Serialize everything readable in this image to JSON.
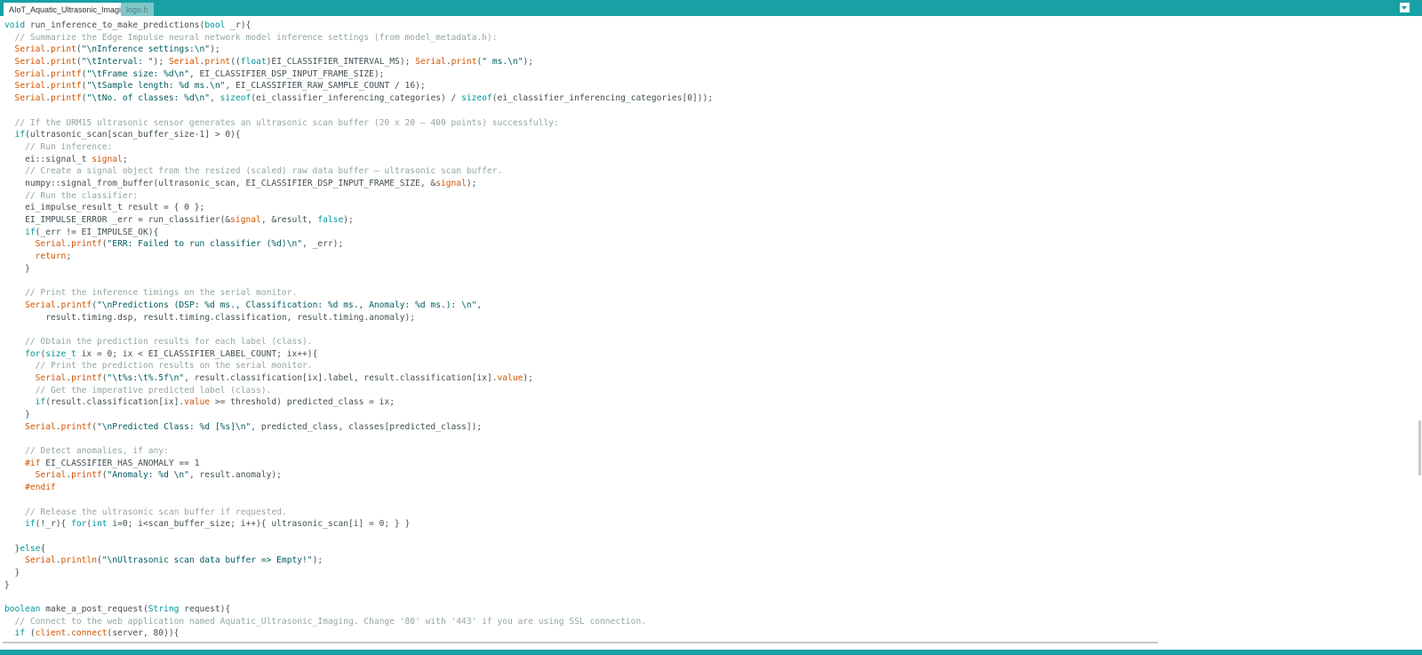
{
  "tabs": [
    {
      "label": "AIoT_Aquatic_Ultrasonic_Imaging",
      "active": true
    },
    {
      "label": "logo.h",
      "active": false
    }
  ],
  "icons": {
    "tab_menu": "chevron-down-icon"
  },
  "colors": {
    "tabbar": "#17a1a5",
    "keyword": "#00979c",
    "object": "#d35400",
    "comment": "#95a5a6",
    "string": "#005c5f",
    "text": "#434f54"
  },
  "code_lines": [
    [
      [
        "kw",
        "void"
      ],
      [
        "t",
        " run_inference_to_make_predictions("
      ],
      [
        "kw",
        "bool"
      ],
      [
        "t",
        " _r){"
      ]
    ],
    [
      [
        "cm",
        "  // Summarize the Edge Impulse neural network model inference settings (from model_metadata.h):"
      ]
    ],
    [
      [
        "obj",
        "  Serial"
      ],
      [
        "t",
        "."
      ],
      [
        "obj",
        "print"
      ],
      [
        "t",
        "("
      ],
      [
        "st",
        "\"\\nInference settings:\\n\""
      ],
      [
        "t",
        ");"
      ]
    ],
    [
      [
        "obj",
        "  Serial"
      ],
      [
        "t",
        "."
      ],
      [
        "obj",
        "print"
      ],
      [
        "t",
        "("
      ],
      [
        "st",
        "\"\\tInterval: \""
      ],
      [
        "t",
        "); "
      ],
      [
        "obj",
        "Serial"
      ],
      [
        "t",
        "."
      ],
      [
        "obj",
        "print"
      ],
      [
        "t",
        "(("
      ],
      [
        "kw",
        "float"
      ],
      [
        "t",
        ")EI_CLASSIFIER_INTERVAL_MS); "
      ],
      [
        "obj",
        "Serial"
      ],
      [
        "t",
        "."
      ],
      [
        "obj",
        "print"
      ],
      [
        "t",
        "("
      ],
      [
        "st",
        "\" ms.\\n\""
      ],
      [
        "t",
        ");"
      ]
    ],
    [
      [
        "obj",
        "  Serial"
      ],
      [
        "t",
        "."
      ],
      [
        "obj",
        "printf"
      ],
      [
        "t",
        "("
      ],
      [
        "st",
        "\"\\tFrame size: %d\\n\""
      ],
      [
        "t",
        ", EI_CLASSIFIER_DSP_INPUT_FRAME_SIZE);"
      ]
    ],
    [
      [
        "obj",
        "  Serial"
      ],
      [
        "t",
        "."
      ],
      [
        "obj",
        "printf"
      ],
      [
        "t",
        "("
      ],
      [
        "st",
        "\"\\tSample length: %d ms.\\n\""
      ],
      [
        "t",
        ", EI_CLASSIFIER_RAW_SAMPLE_COUNT / 16);"
      ]
    ],
    [
      [
        "obj",
        "  Serial"
      ],
      [
        "t",
        "."
      ],
      [
        "obj",
        "printf"
      ],
      [
        "t",
        "("
      ],
      [
        "st",
        "\"\\tNo. of classes: %d\\n\""
      ],
      [
        "t",
        ", "
      ],
      [
        "kw",
        "sizeof"
      ],
      [
        "t",
        "(ei_classifier_inferencing_categories) / "
      ],
      [
        "kw",
        "sizeof"
      ],
      [
        "t",
        "(ei_classifier_inferencing_categories[0]));"
      ]
    ],
    [
      [
        "t",
        ""
      ]
    ],
    [
      [
        "cm",
        "  // If the URM15 ultrasonic sensor generates an ultrasonic scan buffer (20 x 20 — 400 points) successfully:"
      ]
    ],
    [
      [
        "kw",
        "  if"
      ],
      [
        "t",
        "(ultrasonic_scan[scan_buffer_size-1] > 0){"
      ]
    ],
    [
      [
        "cm",
        "    // Run inference:"
      ]
    ],
    [
      [
        "t",
        "    ei::signal_t "
      ],
      [
        "obj",
        "signal"
      ],
      [
        "t",
        ";"
      ]
    ],
    [
      [
        "cm",
        "    // Create a signal object from the resized (scaled) raw data buffer — ultrasonic scan buffer."
      ]
    ],
    [
      [
        "t",
        "    numpy::signal_from_buffer(ultrasonic_scan, EI_CLASSIFIER_DSP_INPUT_FRAME_SIZE, &"
      ],
      [
        "obj",
        "signal"
      ],
      [
        "t",
        ");"
      ]
    ],
    [
      [
        "cm",
        "    // Run the classifier:"
      ]
    ],
    [
      [
        "t",
        "    ei_impulse_result_t result = { 0 };"
      ]
    ],
    [
      [
        "t",
        "    EI_IMPULSE_ERROR _err = run_classifier(&"
      ],
      [
        "obj",
        "signal"
      ],
      [
        "t",
        ", &result, "
      ],
      [
        "kw",
        "false"
      ],
      [
        "t",
        ");"
      ]
    ],
    [
      [
        "kw",
        "    if"
      ],
      [
        "t",
        "(_err != EI_IMPULSE_OK){"
      ]
    ],
    [
      [
        "obj",
        "      Serial"
      ],
      [
        "t",
        "."
      ],
      [
        "obj",
        "printf"
      ],
      [
        "t",
        "("
      ],
      [
        "st",
        "\"ERR: Failed to run classifier (%d)\\n\""
      ],
      [
        "t",
        ", _err);"
      ]
    ],
    [
      [
        "obj",
        "      return"
      ],
      [
        "t",
        ";"
      ]
    ],
    [
      [
        "t",
        "    }"
      ]
    ],
    [
      [
        "t",
        ""
      ]
    ],
    [
      [
        "cm",
        "    // Print the inference timings on the serial monitor."
      ]
    ],
    [
      [
        "obj",
        "    Serial"
      ],
      [
        "t",
        "."
      ],
      [
        "obj",
        "printf"
      ],
      [
        "t",
        "("
      ],
      [
        "st",
        "\"\\nPredictions (DSP: %d ms., Classification: %d ms., Anomaly: %d ms.): \\n\""
      ],
      [
        "t",
        ","
      ]
    ],
    [
      [
        "t",
        "        result.timing.dsp, result.timing.classification, result.timing.anomaly);"
      ]
    ],
    [
      [
        "t",
        ""
      ]
    ],
    [
      [
        "cm",
        "    // Obtain the prediction results for each label (class)."
      ]
    ],
    [
      [
        "kw",
        "    for"
      ],
      [
        "t",
        "("
      ],
      [
        "kw",
        "size_t"
      ],
      [
        "t",
        " ix = 0; ix < EI_CLASSIFIER_LABEL_COUNT; ix++){"
      ]
    ],
    [
      [
        "cm",
        "      // Print the prediction results on the serial monitor."
      ]
    ],
    [
      [
        "obj",
        "      Serial"
      ],
      [
        "t",
        "."
      ],
      [
        "obj",
        "printf"
      ],
      [
        "t",
        "("
      ],
      [
        "st",
        "\"\\t%s:\\t%.5f\\n\""
      ],
      [
        "t",
        ", result.classification[ix].label, result.classification[ix]."
      ],
      [
        "obj",
        "value"
      ],
      [
        "t",
        ");"
      ]
    ],
    [
      [
        "cm",
        "      // Get the imperative predicted label (class)."
      ]
    ],
    [
      [
        "kw",
        "      if"
      ],
      [
        "t",
        "(result.classification[ix]."
      ],
      [
        "obj",
        "value"
      ],
      [
        "t",
        " >= threshold) predicted_class = ix;"
      ]
    ],
    [
      [
        "t",
        "    }"
      ]
    ],
    [
      [
        "obj",
        "    Serial"
      ],
      [
        "t",
        "."
      ],
      [
        "obj",
        "printf"
      ],
      [
        "t",
        "("
      ],
      [
        "st",
        "\"\\nPredicted Class: %d [%s]\\n\""
      ],
      [
        "t",
        ", predicted_class, classes[predicted_class]);"
      ]
    ],
    [
      [
        "t",
        ""
      ]
    ],
    [
      [
        "cm",
        "    // Detect anomalies, if any:"
      ]
    ],
    [
      [
        "obj",
        "    #if"
      ],
      [
        "t",
        " EI_CLASSIFIER_HAS_ANOMALY == 1"
      ]
    ],
    [
      [
        "obj",
        "      Serial"
      ],
      [
        "t",
        "."
      ],
      [
        "obj",
        "printf"
      ],
      [
        "t",
        "("
      ],
      [
        "st",
        "\"Anomaly: %d \\n\""
      ],
      [
        "t",
        ", result.anomaly);"
      ]
    ],
    [
      [
        "obj",
        "    #endif"
      ]
    ],
    [
      [
        "t",
        ""
      ]
    ],
    [
      [
        "cm",
        "    // Release the ultrasonic scan buffer if requested."
      ]
    ],
    [
      [
        "kw",
        "    if"
      ],
      [
        "t",
        "(!_r){ "
      ],
      [
        "kw",
        "for"
      ],
      [
        "t",
        "("
      ],
      [
        "kw",
        "int"
      ],
      [
        "t",
        " i=0; i<scan_buffer_size; i++){ ultrasonic_scan[i] = 0; } }"
      ]
    ],
    [
      [
        "t",
        ""
      ]
    ],
    [
      [
        "t",
        "  }"
      ],
      [
        "kw",
        "else"
      ],
      [
        "t",
        "{"
      ]
    ],
    [
      [
        "obj",
        "    Serial"
      ],
      [
        "t",
        "."
      ],
      [
        "obj",
        "println"
      ],
      [
        "t",
        "("
      ],
      [
        "st",
        "\"\\nUltrasonic scan data buffer => Empty!\""
      ],
      [
        "t",
        ");"
      ]
    ],
    [
      [
        "t",
        "  }"
      ]
    ],
    [
      [
        "t",
        "}"
      ]
    ],
    [
      [
        "t",
        ""
      ]
    ],
    [
      [
        "kw",
        "boolean"
      ],
      [
        "t",
        " make_a_post_request("
      ],
      [
        "kw",
        "String"
      ],
      [
        "t",
        " request){"
      ]
    ],
    [
      [
        "cm",
        "  // Connect to the web application named Aquatic_Ultrasonic_Imaging. Change '80' with '443' if you are using SSL connection."
      ]
    ],
    [
      [
        "kw",
        "  if"
      ],
      [
        "t",
        " ("
      ],
      [
        "obj",
        "client"
      ],
      [
        "t",
        "."
      ],
      [
        "obj",
        "connect"
      ],
      [
        "t",
        "(server, 80)){"
      ]
    ]
  ]
}
